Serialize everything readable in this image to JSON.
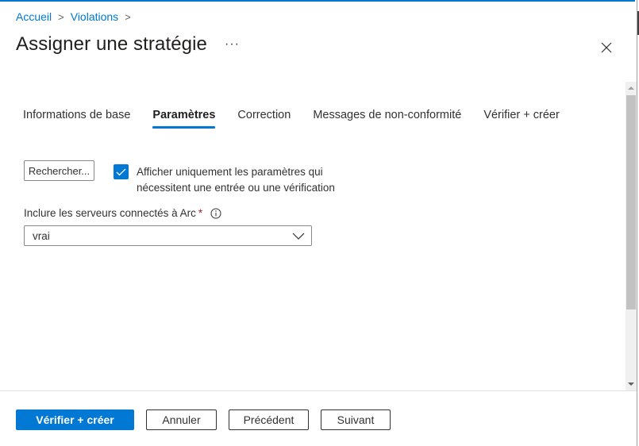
{
  "breadcrumb": {
    "items": [
      {
        "label": "Accueil"
      },
      {
        "label": "Violations"
      }
    ]
  },
  "header": {
    "title": "Assigner une stratégie",
    "more_label": "···",
    "close_icon": "close-icon"
  },
  "tabs": [
    {
      "label": "Informations de base",
      "active": false
    },
    {
      "label": "Paramètres",
      "active": true
    },
    {
      "label": "Correction",
      "active": false
    },
    {
      "label": "Messages de non-conformité",
      "active": false
    },
    {
      "label": "Vérifier + créer",
      "active": false
    }
  ],
  "parameters": {
    "search_button_label": "Rechercher...",
    "filter_checkbox": {
      "checked": true,
      "label": "Afficher uniquement les paramètres qui nécessitent une entrée ou une vérification"
    },
    "arc_field": {
      "label": "Inclure les serveurs connectés à Arc",
      "required_marker": "*",
      "info_icon": "info-icon",
      "selected_value": "vrai"
    }
  },
  "footer": {
    "review_create_label": "Vérifier + créer",
    "cancel_label": "Annuler",
    "previous_label": "Précédent",
    "next_label": "Suivant"
  },
  "colors": {
    "accent": "#0078d4",
    "required": "#a4262c",
    "text": "#323130"
  }
}
